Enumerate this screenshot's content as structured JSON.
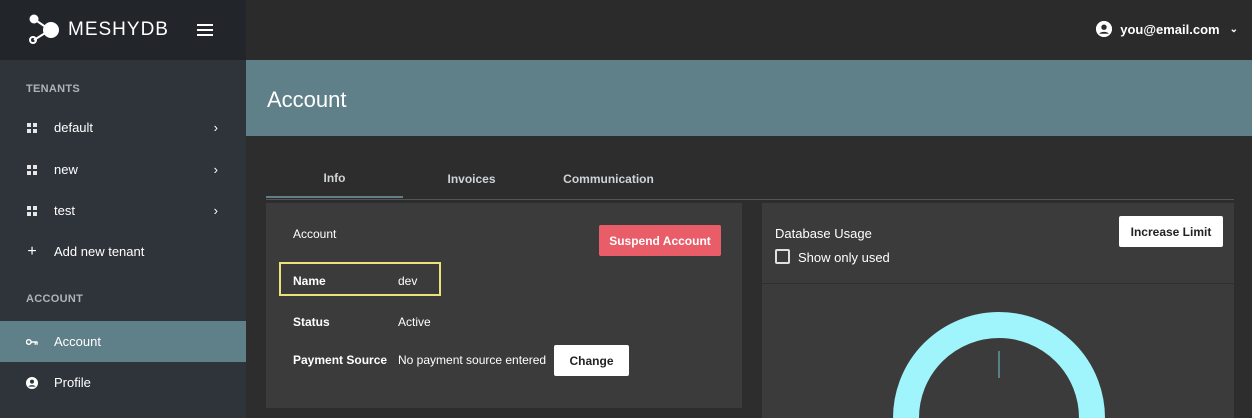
{
  "brand": {
    "name": "MESHYDB"
  },
  "sidebar": {
    "tenants_header": "TENANTS",
    "tenants": [
      {
        "label": "default"
      },
      {
        "label": "new"
      },
      {
        "label": "test"
      }
    ],
    "add_tenant": "Add new tenant",
    "account_header": "ACCOUNT",
    "account_items": [
      {
        "label": "Account",
        "icon": "key-icon",
        "active": true
      },
      {
        "label": "Profile",
        "icon": "user-circle-icon",
        "active": false
      }
    ]
  },
  "topbar": {
    "user_email": "you@email.com"
  },
  "page": {
    "title": "Account"
  },
  "tabs": [
    {
      "label": "Info",
      "active": true
    },
    {
      "label": "Invoices",
      "active": false
    },
    {
      "label": "Communication",
      "active": false
    }
  ],
  "account_card": {
    "title": "Account",
    "suspend_label": "Suspend Account",
    "name_label": "Name",
    "name_value": "dev",
    "status_label": "Status",
    "status_value": "Active",
    "payment_label": "Payment Source",
    "payment_value": "No payment source entered",
    "change_label": "Change"
  },
  "usage_card": {
    "title": "Database Usage",
    "increase_label": "Increase Limit",
    "show_only_used_label": "Show only used",
    "show_only_used_checked": false
  },
  "colors": {
    "accent": "#5f7f89",
    "danger": "#e85d68",
    "highlight": "#ebe27a",
    "donut": "#9ff5fb"
  }
}
